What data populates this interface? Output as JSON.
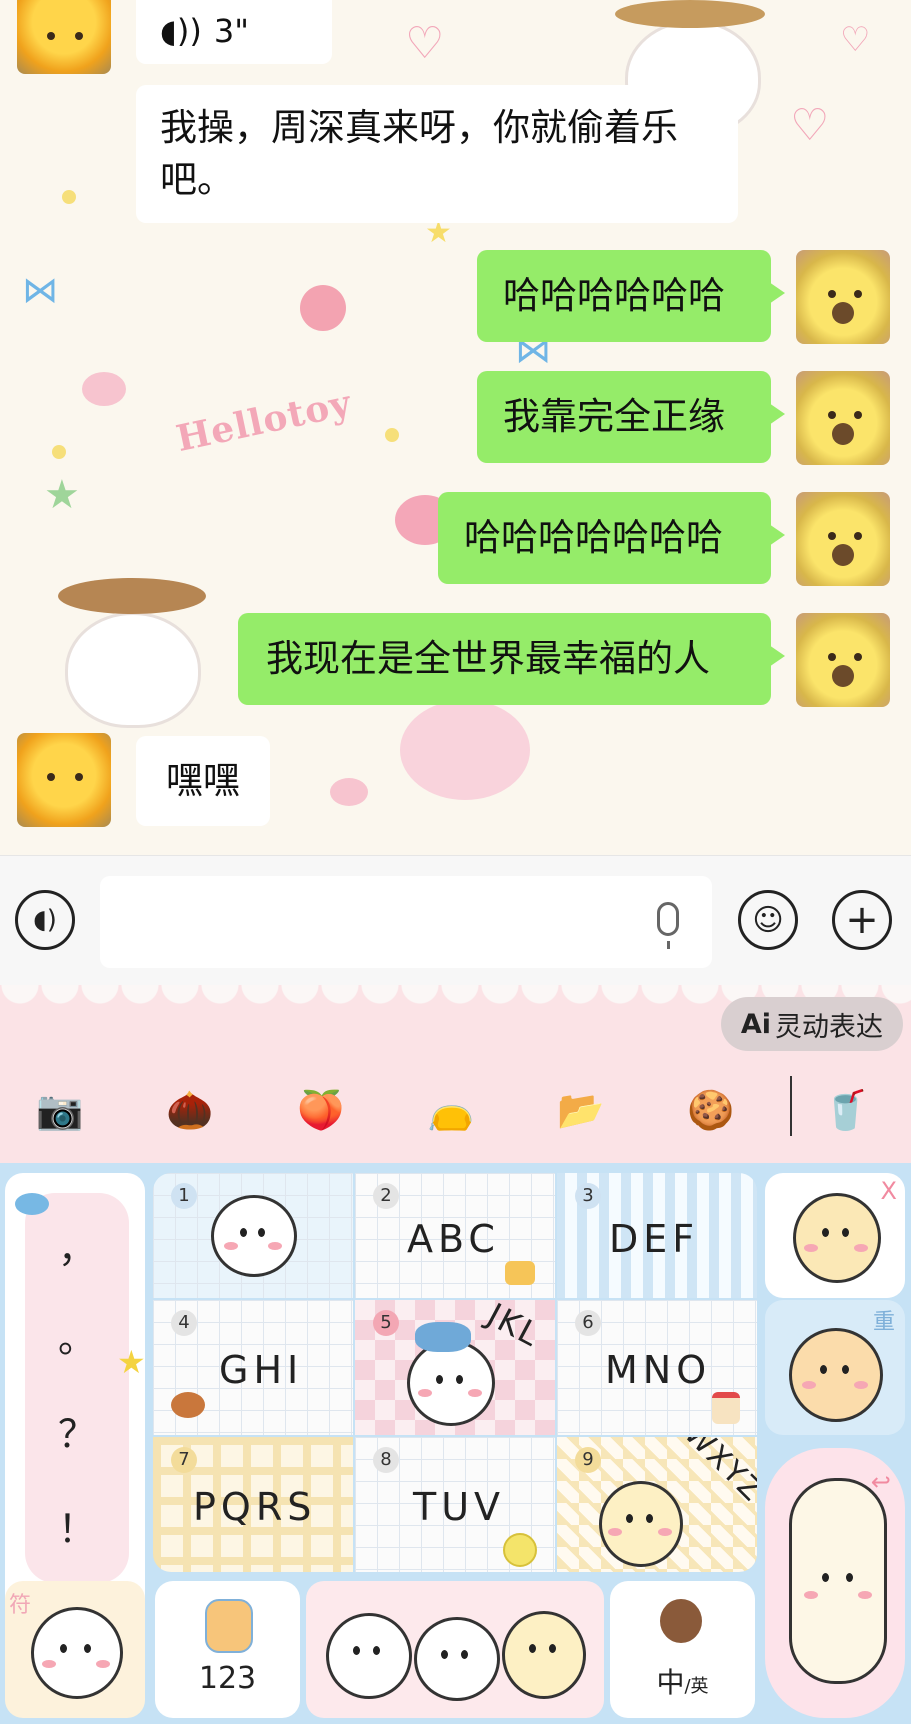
{
  "chat": {
    "messages": [
      {
        "side": "in",
        "type": "voice",
        "duration": "3\""
      },
      {
        "side": "in",
        "type": "text",
        "lines": [
          "我操，周深真来呀，你就偷着乐",
          "吧。"
        ]
      },
      {
        "side": "out",
        "type": "text",
        "text": "哈哈哈哈哈哈"
      },
      {
        "side": "out",
        "type": "text",
        "text": "我靠完全正缘"
      },
      {
        "side": "out",
        "type": "text",
        "text": "哈哈哈哈哈哈哈"
      },
      {
        "side": "out",
        "type": "text",
        "text": "我现在是全世界最幸福的人"
      },
      {
        "side": "in",
        "type": "text",
        "text": "嘿嘿"
      }
    ],
    "wallpaper_text": "Hellotoy",
    "colors": {
      "outgoing_bubble": "#95ec69",
      "incoming_bubble": "#ffffff"
    }
  },
  "input_bar": {
    "voice_icon": "voice-mode-icon",
    "text_value": "",
    "mic_icon": "microphone-icon",
    "emoji_icon": "emoji-icon",
    "plus_icon": "plus-icon"
  },
  "keyboard": {
    "ai_prefix": "Ai",
    "ai_label": "灵动表达",
    "toolbar_icons": [
      "camera-icon",
      "acorn-icon",
      "peach-icon",
      "sack-icon",
      "folder-icon",
      "snack-bag-icon",
      "cup-icon"
    ],
    "punctuation": [
      "，",
      "。",
      "？",
      "！"
    ],
    "keys": [
      {
        "num": "1",
        "label": ""
      },
      {
        "num": "2",
        "label": "ABC"
      },
      {
        "num": "3",
        "label": "DEF"
      },
      {
        "num": "4",
        "label": "GHI"
      },
      {
        "num": "5",
        "label": "JKL"
      },
      {
        "num": "6",
        "label": "MNO"
      },
      {
        "num": "7",
        "label": "PQRS"
      },
      {
        "num": "8",
        "label": "TUV"
      },
      {
        "num": "9",
        "label": "WXYZ"
      }
    ],
    "delete_mark": "X",
    "reenter_label": "重",
    "symbol_label": "符",
    "number_label": "123",
    "lang_label": "中",
    "lang_sub": "/英",
    "enter_mark": "↩"
  }
}
